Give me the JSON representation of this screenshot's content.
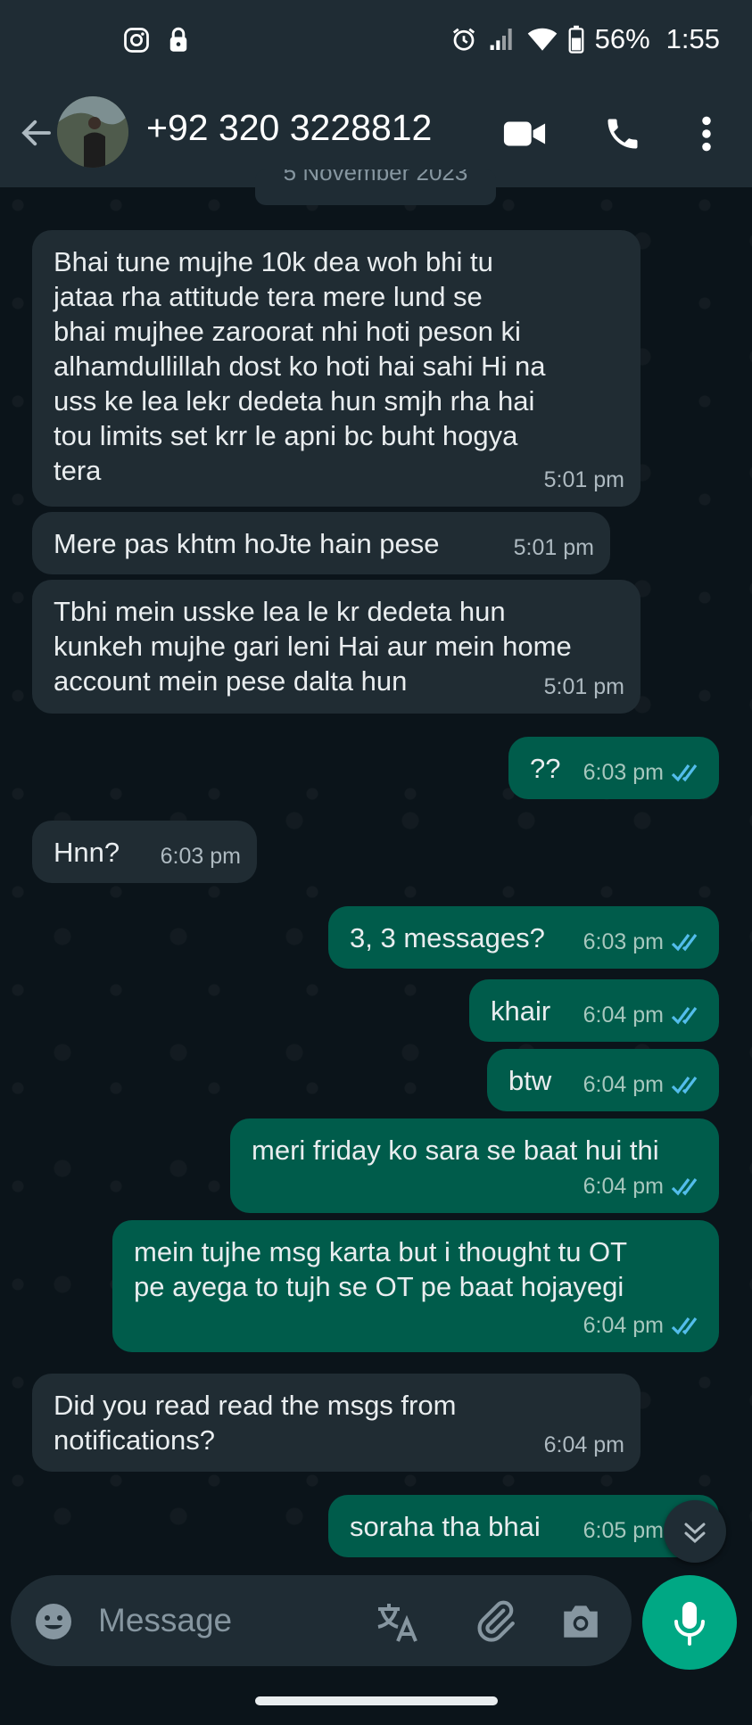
{
  "status_bar": {
    "battery": "56%",
    "time": "1:55",
    "left_icons": [
      "instagram-icon",
      "lock-icon"
    ],
    "right_icons": [
      "alarm-icon",
      "signal-icon",
      "wifi-icon",
      "battery-icon"
    ]
  },
  "header": {
    "contact": "+92 320 3228812",
    "actions": [
      "video-call-icon",
      "voice-call-icon",
      "more-options-icon"
    ]
  },
  "date_chip": "5 November 2023",
  "messages": [
    {
      "dir": "in",
      "text": "Bhai tune mujhe 10k dea woh bhi tu\njataa rha attitude tera mere lund se\nbhai mujhee zaroorat nhi hoti peson ki\nalhamdullillah dost ko hoti hai sahi Hi na\nuss ke lea lekr dedeta hun smjh rha hai\ntou limits set krr le apni bc buht hogya\ntera",
      "time": "5:01 pm"
    },
    {
      "dir": "in",
      "text": "Mere pas khtm hoJte hain pese",
      "time": "5:01 pm"
    },
    {
      "dir": "in",
      "text": "Tbhi mein usske lea le kr dedeta hun\nkunkeh mujhe gari leni Hai aur mein home\naccount mein pese dalta hun",
      "time": "5:01 pm"
    },
    {
      "dir": "out",
      "text": "??",
      "time": "6:03 pm",
      "status": "read"
    },
    {
      "dir": "in",
      "text": "Hnn?",
      "time": "6:03 pm"
    },
    {
      "dir": "out",
      "text": "3, 3 messages?",
      "time": "6:03 pm",
      "status": "read"
    },
    {
      "dir": "out",
      "text": "khair",
      "time": "6:04 pm",
      "status": "read"
    },
    {
      "dir": "out",
      "text": "btw",
      "time": "6:04 pm",
      "status": "read"
    },
    {
      "dir": "out",
      "text": "meri friday ko sara se baat hui thi",
      "time": "6:04 pm",
      "status": "read"
    },
    {
      "dir": "out",
      "text": "mein tujhe msg karta but i thought tu OT\npe ayega to tujh se OT pe baat hojayegi",
      "time": "6:04 pm",
      "status": "read"
    },
    {
      "dir": "in",
      "text": "Did you read read the msgs from\nnotifications?",
      "time": "6:04 pm"
    },
    {
      "dir": "out",
      "text": "soraha tha bhai",
      "time": "6:05 pm",
      "status": "read"
    }
  ],
  "composer": {
    "placeholder": "Message",
    "icons": [
      "emoji-icon",
      "translate-icon",
      "attach-icon",
      "camera-icon",
      "mic-icon"
    ]
  },
  "colors": {
    "background": "#0b141a",
    "bar": "#1f2c34",
    "incoming": "#202c33",
    "outgoing": "#005c4b",
    "accent": "#00a884",
    "read_tick": "#53bdeb"
  }
}
